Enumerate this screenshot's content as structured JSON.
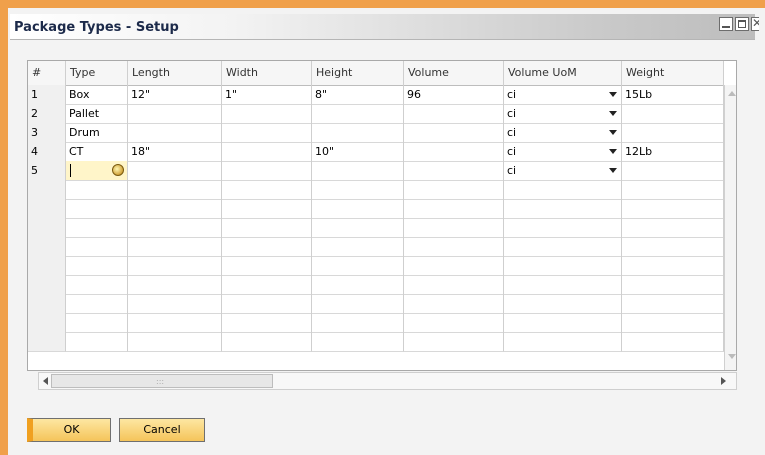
{
  "window": {
    "title": "Package Types - Setup"
  },
  "table": {
    "columns": [
      "#",
      "Type",
      "Length",
      "Width",
      "Height",
      "Volume",
      "Volume UoM",
      "Weight"
    ],
    "rows": [
      {
        "num": "1",
        "type": "Box",
        "length": "12\"",
        "width": "1\"",
        "height": "8\"",
        "volume": "96",
        "uom": "ci",
        "weight": "15Lb"
      },
      {
        "num": "2",
        "type": "Pallet",
        "length": "",
        "width": "",
        "height": "",
        "volume": "",
        "uom": "ci",
        "weight": ""
      },
      {
        "num": "3",
        "type": "Drum",
        "length": "",
        "width": "",
        "height": "",
        "volume": "",
        "uom": "ci",
        "weight": ""
      },
      {
        "num": "4",
        "type": "CT",
        "length": "18\"",
        "width": "",
        "height": "10\"",
        "volume": "",
        "uom": "ci",
        "weight": "12Lb"
      },
      {
        "num": "5",
        "type": "",
        "length": "",
        "width": "",
        "height": "",
        "volume": "",
        "uom": "ci",
        "weight": ""
      }
    ],
    "empty_rows": 9
  },
  "buttons": {
    "ok": "OK",
    "cancel": "Cancel"
  },
  "colors": {
    "frame_accent": "#f0a04a",
    "button_fill": "#f5c45a",
    "active_cell": "#fff5c9"
  },
  "icons": {
    "lookup": "lookup-globe-icon",
    "dropdown": "dropdown-arrow-icon"
  }
}
